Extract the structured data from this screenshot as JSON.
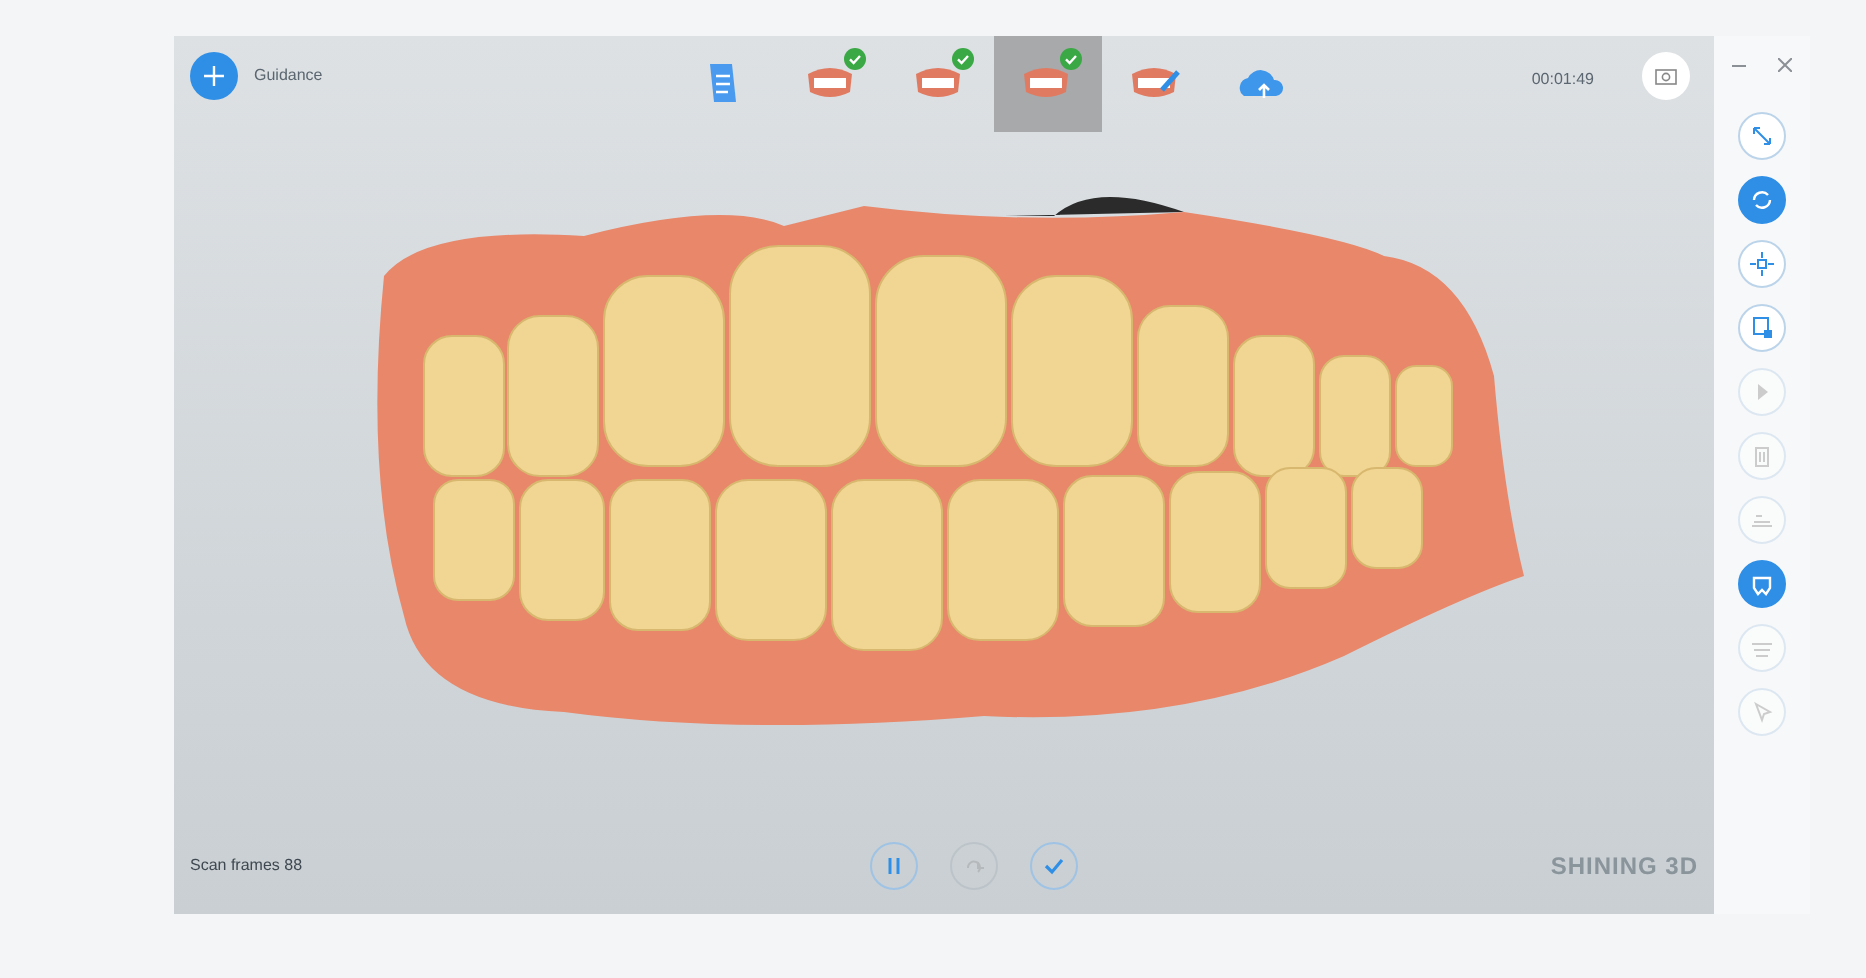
{
  "header": {
    "guidance_label": "Guidance",
    "timer": "00:01:49"
  },
  "steps": [
    {
      "kind": "notes",
      "done": false,
      "selected": false
    },
    {
      "kind": "upper",
      "done": true,
      "selected": false
    },
    {
      "kind": "lower",
      "done": true,
      "selected": false
    },
    {
      "kind": "bite",
      "done": true,
      "selected": true
    },
    {
      "kind": "edit",
      "done": false,
      "selected": false
    },
    {
      "kind": "upload",
      "done": false,
      "selected": false
    }
  ],
  "tools": [
    {
      "kind": "expand",
      "active": false,
      "disabled": false
    },
    {
      "kind": "rotate",
      "active": true,
      "disabled": false
    },
    {
      "kind": "move",
      "active": false,
      "disabled": false
    },
    {
      "kind": "lock",
      "active": false,
      "disabled": false
    },
    {
      "kind": "play",
      "active": false,
      "disabled": true
    },
    {
      "kind": "trash",
      "active": false,
      "disabled": true
    },
    {
      "kind": "layers",
      "active": false,
      "disabled": true
    },
    {
      "kind": "teeth",
      "active": true,
      "disabled": false
    },
    {
      "kind": "contour",
      "active": false,
      "disabled": true
    },
    {
      "kind": "cursor",
      "active": false,
      "disabled": true
    }
  ],
  "status": {
    "scan_frames": "Scan frames 88",
    "brand": "SHINING 3D"
  },
  "bottom_controls": [
    {
      "kind": "pause",
      "disabled": false
    },
    {
      "kind": "redo",
      "disabled": true
    },
    {
      "kind": "confirm",
      "disabled": false
    }
  ]
}
